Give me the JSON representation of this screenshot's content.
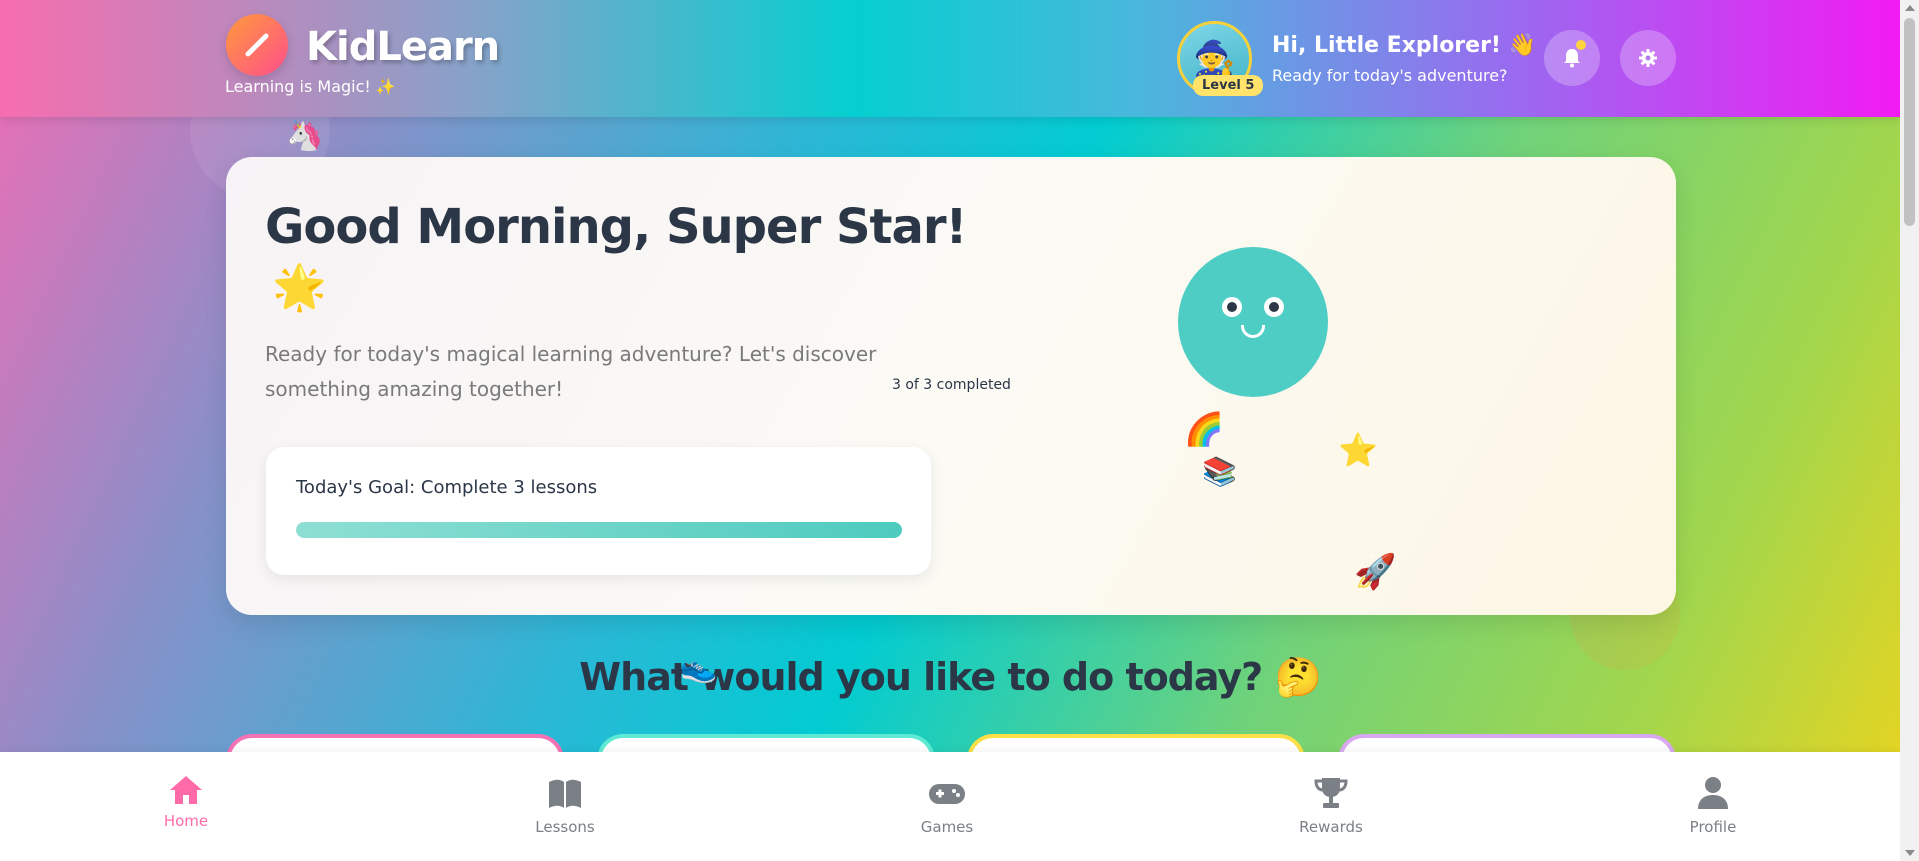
{
  "app": {
    "name": "KidLearn",
    "tagline": "Learning is Magic! ✨"
  },
  "user": {
    "greeting": "Hi, Little Explorer! 👋",
    "subtext": "Ready for today's adventure?",
    "level": "Level 5",
    "avatar_emoji": "🧙"
  },
  "header_icons": [
    "bell-icon",
    "gear-icon"
  ],
  "hero": {
    "title": "Good Morning, Super Star!",
    "title_emoji": "🌟",
    "description": "Ready for today's magical learning adventure? Let's discover something amazing together!",
    "progress_label": "3 of 3 completed",
    "goal_text": "Today's Goal: Complete 3 lessons",
    "goal_progress": 1.0
  },
  "decorations": {
    "unicorn": "🦄",
    "rainbow": "🌈",
    "books": "📚",
    "star": "⭐",
    "rocket": "🚀",
    "sneaker": "👟"
  },
  "section": {
    "title": "What would you like to do today? 🤔"
  },
  "action_card_colors": [
    "#f472b6",
    "#5eead4",
    "#fde047",
    "#d8a8f0"
  ],
  "bottom_nav": [
    {
      "label": "Home",
      "icon": "home-icon",
      "active": true
    },
    {
      "label": "Lessons",
      "icon": "book-icon",
      "active": false
    },
    {
      "label": "Games",
      "icon": "gamepad-icon",
      "active": false
    },
    {
      "label": "Rewards",
      "icon": "trophy-icon",
      "active": false
    },
    {
      "label": "Profile",
      "icon": "user-icon",
      "active": false
    }
  ],
  "colors": {
    "accent": "#ff6aa9",
    "teal": "#4ecdc4",
    "dark_text": "#2b3646"
  }
}
